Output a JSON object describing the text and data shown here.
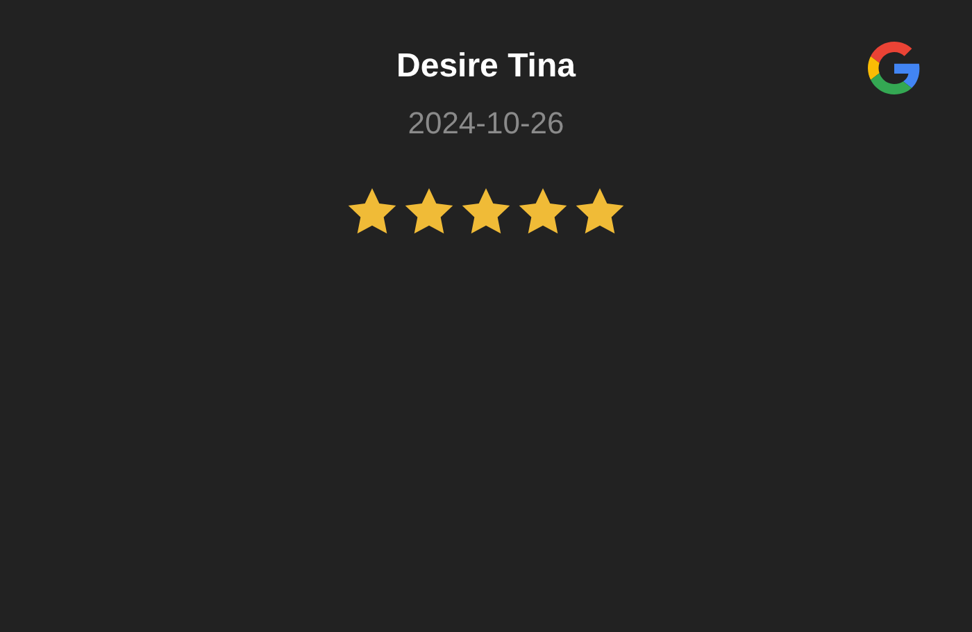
{
  "review": {
    "author": "Desire Tina",
    "date": "2024-10-26",
    "stars": 5
  }
}
